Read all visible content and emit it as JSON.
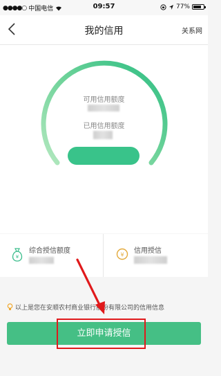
{
  "status_bar": {
    "carrier": "中国电信",
    "time": "09:57",
    "battery": "77%"
  },
  "nav": {
    "title": "我的信用",
    "right_action": "关系网"
  },
  "gauge": {
    "available_credit_label": "可用信用额度",
    "used_credit_label": "已用信用额度",
    "colors": {
      "track_start": "#a9e4b7",
      "track_end": "#2fbf83"
    }
  },
  "summary": {
    "total_credit_label": "综合授信额度",
    "credit_label": "信用授信"
  },
  "note": {
    "text": "以上是您在安顺农村商业银行股份有限公司的信用信息"
  },
  "apply_button": {
    "label": "立即申请授信",
    "color": "#45bf85"
  },
  "annotation": {
    "color": "#e0191b"
  }
}
